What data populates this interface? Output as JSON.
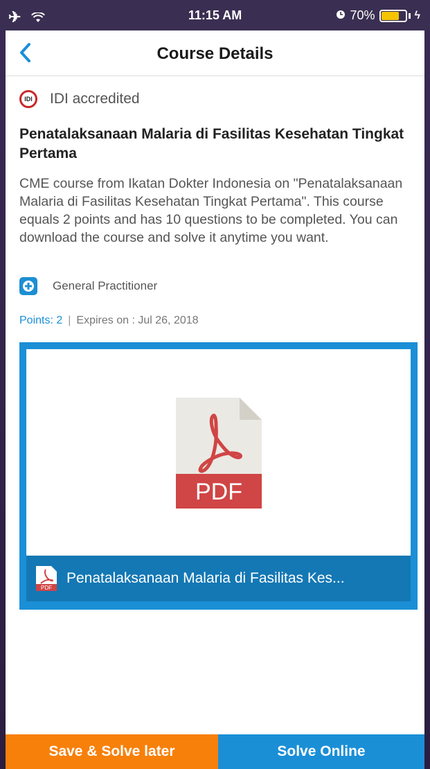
{
  "status_bar": {
    "time": "11:15 AM",
    "battery_percent": "70%",
    "battery_level": 0.7,
    "icons": [
      "airplane-mode-icon",
      "wifi-icon",
      "alarm-icon",
      "battery-icon",
      "charging-icon"
    ]
  },
  "nav": {
    "title": "Course Details",
    "back_icon": "chevron-left-icon"
  },
  "course": {
    "accreditation": "IDI accredited",
    "title": "Penatalaksanaan Malaria di Fasilitas Kesehatan Tingkat Pertama",
    "description": "CME course from Ikatan Dokter Indonesia on \"Penatalaksanaan Malaria di Fasilitas Kesehatan Tingkat Pertama\". This course equals 2 points and has 10 questions to be completed. You can download the course and solve it anytime you want.",
    "specialty": "General Practitioner",
    "points": "Points: 2",
    "separator": "|",
    "expires": "Expires on : Jul 26, 2018"
  },
  "attachment": {
    "file_label": "PDF",
    "file_name": "Penatalaksanaan Malaria di Fasilitas Kes...",
    "icon": "pdf-icon"
  },
  "actions": {
    "save_label": "Save & Solve later",
    "solve_label": "Solve Online"
  },
  "colors": {
    "accent_blue": "#1a8fd6",
    "accent_orange": "#f7800a",
    "pdf_red": "#d04545"
  }
}
